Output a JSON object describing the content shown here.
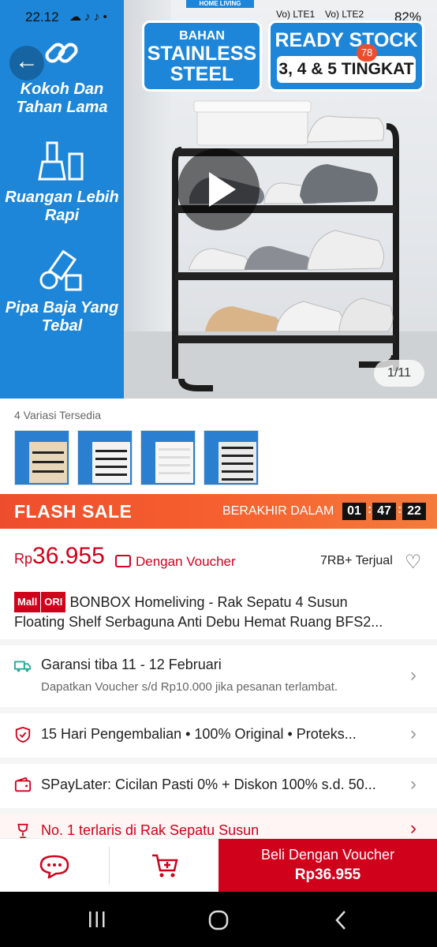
{
  "status_bar": {
    "time": "22.12",
    "battery": "82%",
    "network_1": "Vo) LTE1",
    "network_2": "Vo) LTE2"
  },
  "hero": {
    "badge_material_line1": "BAHAN",
    "badge_material_line2": "STAINLESS STEEL",
    "badge_stock_line1": "READY STOCK",
    "badge_stock_line2": "3, 4 & 5 TINGKAT",
    "top_label": "HOME LIVING",
    "cart_count": "78",
    "feature_1": "Kokoh Dan Tahan Lama",
    "feature_2": "Ruangan Lebih Rapi",
    "feature_3": "Pipa Baja Yang Tebal",
    "page_counter": "1/11"
  },
  "variations": {
    "label": "4 Variasi Tersedia",
    "count": 4
  },
  "flash_sale": {
    "title": "FLASH SALE",
    "ends_label": "BERAKHIR DALAM",
    "hours": "01",
    "minutes": "47",
    "seconds": "22"
  },
  "price": {
    "currency": "Rp",
    "value": "36.955",
    "voucher_text": "Dengan Voucher",
    "sold": "7RB+ Terjual"
  },
  "product": {
    "badge_mall": "Mall",
    "badge_ori": "ORI",
    "title_line1": "BONBOX Homeliving - Rak Sepatu 4 Susun",
    "title_line2": "Floating Shelf Serbaguna Anti Debu Hemat Ruang BFS2..."
  },
  "info_rows": {
    "shipping_title": "Garansi tiba 11 - 12 Februari",
    "shipping_sub": "Dapatkan Voucher s/d Rp10.000 jika pesanan terlambat.",
    "guarantee": "15 Hari Pengembalian  •  100% Original  •  Proteks...",
    "paylater": "SPayLater: Cicilan Pasti 0% + Diskon 100% s.d. 50...",
    "ranking": "No. 1 terlaris di Rak Sepatu Susun"
  },
  "bottom_bar": {
    "buy_label": "Beli Dengan Voucher",
    "buy_price": "Rp36.955"
  },
  "colors": {
    "brand_red": "#d0011b",
    "flash_orange": "#ee4d2d",
    "hero_blue": "#1e86d8"
  }
}
